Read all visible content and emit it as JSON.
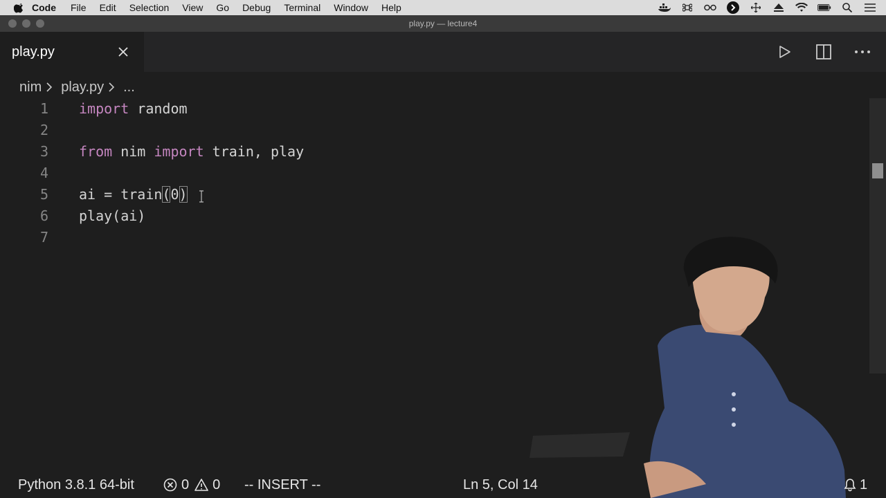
{
  "menubar": {
    "app_name": "Code",
    "items": [
      "File",
      "Edit",
      "Selection",
      "View",
      "Go",
      "Debug",
      "Terminal",
      "Window",
      "Help"
    ],
    "tray_icons": [
      "docker-icon",
      "command-icon",
      "glasses-icon",
      "circle-arrow-icon",
      "move-icon",
      "eject-icon",
      "wifi-icon",
      "battery-icon",
      "search-icon",
      "list-icon"
    ]
  },
  "window": {
    "title": "play.py — lecture4"
  },
  "tab": {
    "label": "play.py"
  },
  "breadcrumb": {
    "folder": "nim",
    "file": "play.py",
    "more": "..."
  },
  "editor": {
    "lines": [
      {
        "num": "1",
        "text": "import random"
      },
      {
        "num": "2",
        "text": ""
      },
      {
        "num": "3",
        "text": "from nim import train, play"
      },
      {
        "num": "4",
        "text": ""
      },
      {
        "num": "5",
        "text": "ai = train(0)"
      },
      {
        "num": "6",
        "text": "play(ai)"
      },
      {
        "num": "7",
        "text": ""
      }
    ],
    "line1": {
      "kw": "import",
      "rest": " random"
    },
    "line3": {
      "kw1": "from",
      "mod": " nim ",
      "kw2": "import",
      "rest": " train, play"
    },
    "line5": {
      "pre": "ai = train",
      "open": "(",
      "arg": "0",
      "close": ")"
    },
    "line6": {
      "text": "play(ai)"
    }
  },
  "status": {
    "python": "Python 3.8.1 64-bit",
    "errors": "0",
    "warnings": "0",
    "mode": "-- INSERT --",
    "position": "Ln 5, Col 14",
    "notifications": "1"
  },
  "colors": {
    "keyword": "#c586c0",
    "background": "#1e1e1e",
    "text": "#d4d4d4"
  }
}
